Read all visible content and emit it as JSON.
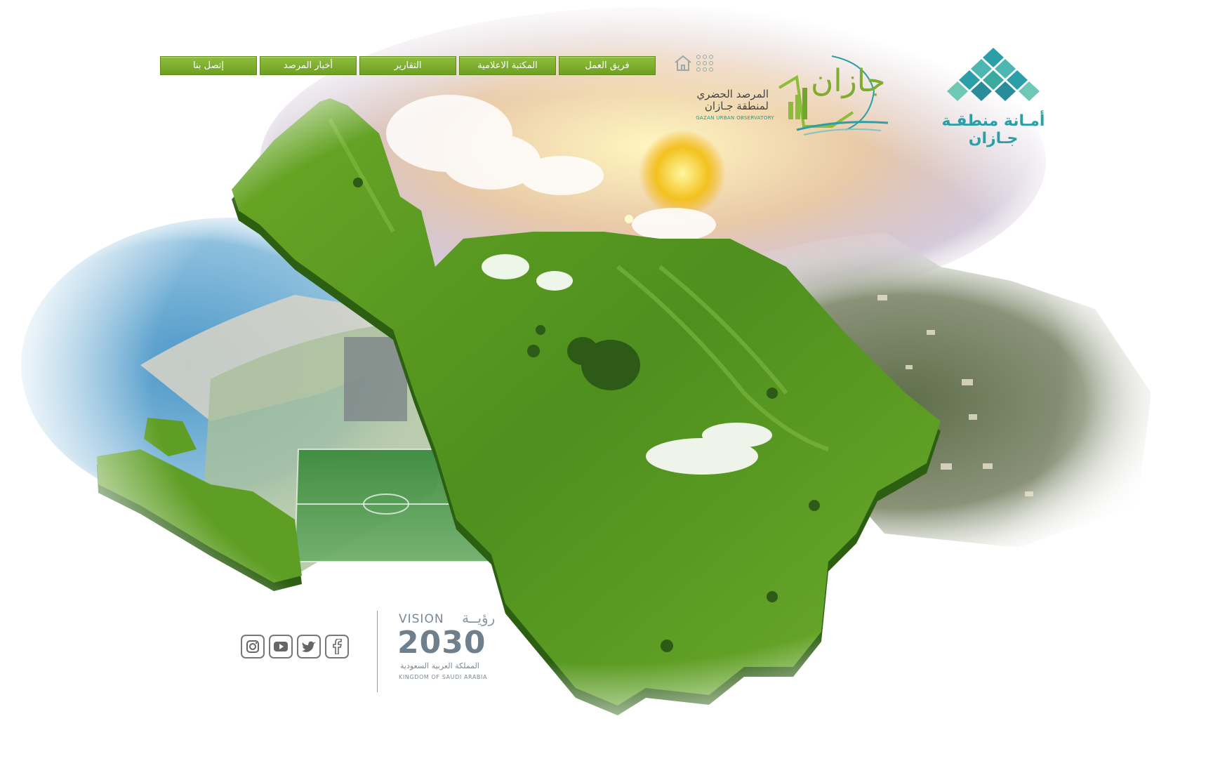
{
  "nav": {
    "items": [
      {
        "label": "إتصل بنا"
      },
      {
        "label": "أخبار المرصد"
      },
      {
        "label": "التقارير"
      },
      {
        "label": "المكتبة الاعلامية"
      },
      {
        "label": "فريق العمل"
      }
    ]
  },
  "observatory": {
    "title_line1": "المرصد الحضري",
    "title_line2": "لمنطقة جـازان",
    "subtitle": "GAZAN URBAN OBSERVATORY",
    "logo_text": "جازان"
  },
  "amanah": {
    "name": "أمـانة منطقـة جـازان"
  },
  "vision": {
    "word": "VISION",
    "word_ar": "رؤيــة",
    "year": "2030",
    "kingdom_ar": "المملكة العربية السعودية",
    "kingdom_en": "KINGDOM OF SAUDI ARABIA"
  },
  "icons": {
    "home": "home-icon",
    "apps": "apps-grid-icon",
    "instagram": "instagram-icon",
    "youtube": "youtube-icon",
    "twitter": "twitter-icon",
    "facebook": "facebook-icon"
  },
  "colors": {
    "nav_green": "#7cac2c",
    "brand_teal": "#2a9fa7",
    "map_green": "#5e9a22"
  }
}
